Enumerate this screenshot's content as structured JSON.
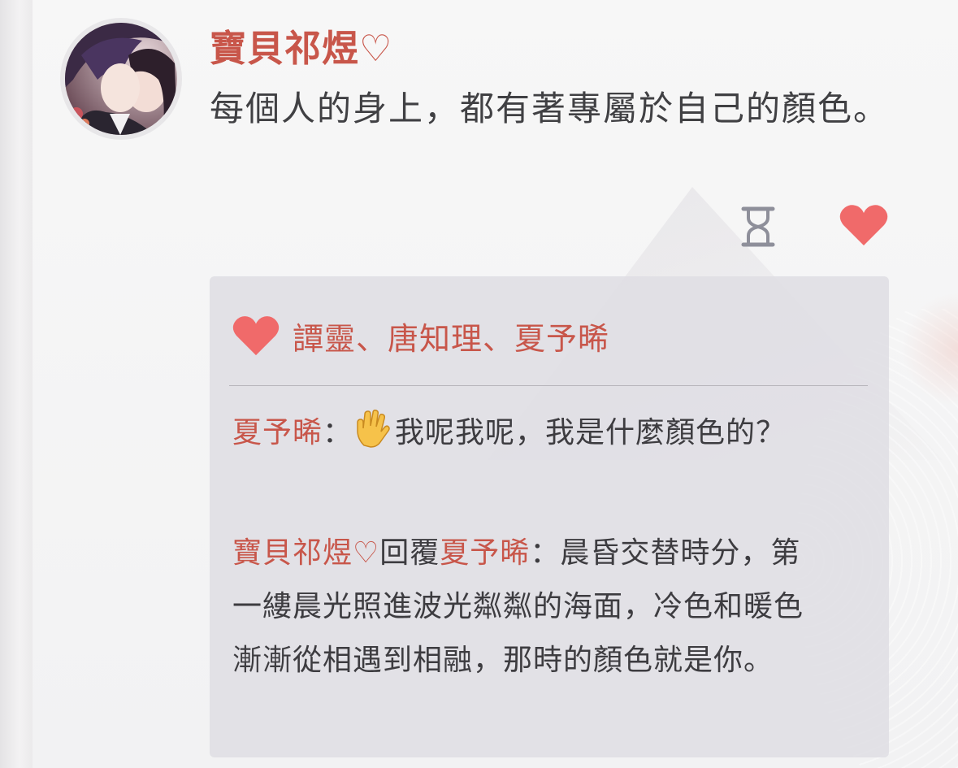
{
  "post": {
    "author": "寶貝祁煜♡",
    "text": "每個人的身上，都有著專屬於自己的顏色。"
  },
  "actions": {
    "icons": [
      "hourglass-icon",
      "heart-icon"
    ],
    "accent_color": "#f06a6a"
  },
  "likes": {
    "icon": "heart-icon",
    "names": "譚靈、唐知理、夏予晞"
  },
  "comments": [
    {
      "author": "夏予晞",
      "separator": "：",
      "emoji": "raised-hand-emoji",
      "text": "我呢我呢，我是什麼顏色的？"
    },
    {
      "author": "寶貝祁煜♡",
      "reply_word": "回覆",
      "reply_to": "夏予晞",
      "separator": "：",
      "text": "晨昏交替時分，第一縷晨光照進波光粼粼的海面，冷色和暖色漸漸從相遇到相融，那時的顏色就是你。"
    }
  ],
  "colors": {
    "name": "#c8564a",
    "text": "#404043",
    "heart": "#f06a6a",
    "comment_bg": "#dedde3"
  }
}
